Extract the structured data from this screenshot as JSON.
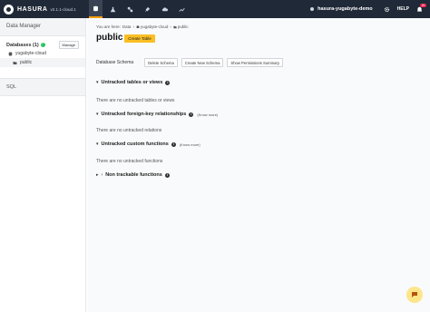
{
  "topbar": {
    "brand": "HASURA",
    "version": "v2.1.1-cloud.1",
    "nav_icons": [
      "data-icon",
      "graphql-icon",
      "actions-icon",
      "remote-schemas-icon",
      "events-icon",
      "monitoring-icon"
    ],
    "project_name": "hasura-yugabyte-demo",
    "help_label": "HELP",
    "notification_count": "20"
  },
  "sidebar": {
    "header": "Data Manager",
    "databases_title": "Databases (1)",
    "manage_label": "Manage",
    "database_name": "yugabyte-cloud",
    "schema_name": "public",
    "sql_label": "SQL"
  },
  "main": {
    "breadcrumb": {
      "prefix": "You are here:",
      "data": "Data",
      "database": "yugabyte-cloud",
      "schema": "public"
    },
    "title": "public",
    "create_table_label": "Create Table",
    "database_schema_label": "Database Schema",
    "schema_buttons": {
      "delete": "Delete Schema",
      "create": "Create New Schema",
      "permissions": "Show Permissions Summary"
    },
    "sections": {
      "untracked_tables_title": "Untracked tables or views",
      "untracked_tables_empty": "There are no untracked tables or views",
      "untracked_fk_title": "Untracked foreign-key relationships",
      "untracked_fk_know_more": "(Know more)",
      "untracked_fk_empty": "There are no untracked relations",
      "untracked_functions_title": "Untracked custom functions",
      "untracked_functions_know_more": "(Know more)",
      "untracked_functions_empty": "There are no untracked functions",
      "non_trackable_title": "Non trackable functions"
    }
  },
  "colors": {
    "topbar": "#1f2937",
    "accent": "#fbbf24",
    "success": "#22c55e",
    "badge": "#e11d48"
  }
}
